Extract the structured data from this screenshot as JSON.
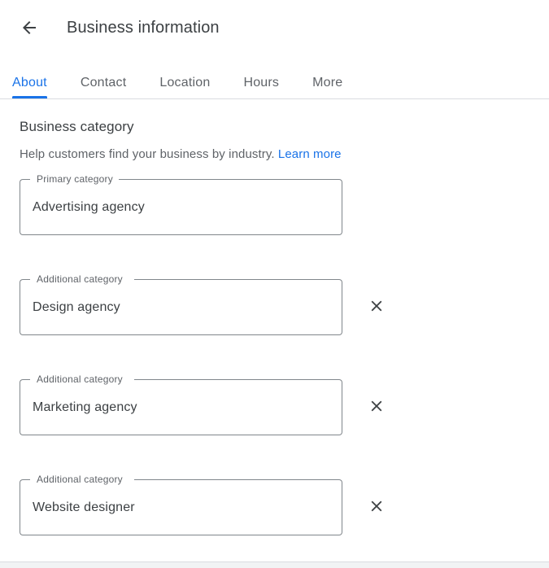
{
  "header": {
    "back_icon": "arrow-left-icon",
    "title": "Business information"
  },
  "tabs": {
    "active": "About",
    "items": [
      {
        "label": "About"
      },
      {
        "label": "Contact"
      },
      {
        "label": "Location"
      },
      {
        "label": "Hours"
      },
      {
        "label": "More"
      }
    ]
  },
  "section": {
    "heading": "Business category",
    "description": "Help customers find your business by industry.",
    "learn_more": "Learn more"
  },
  "fields": [
    {
      "label": "Primary category",
      "value": "Advertising agency",
      "removable": false,
      "remove_icon": ""
    },
    {
      "label": "Additional category",
      "value": "Design agency",
      "removable": true,
      "remove_icon": "close-icon"
    },
    {
      "label": "Additional category",
      "value": "Marketing agency",
      "removable": true,
      "remove_icon": "close-icon"
    },
    {
      "label": "Additional category",
      "value": "Website designer",
      "removable": true,
      "remove_icon": "close-icon"
    }
  ],
  "colors": {
    "accent": "#1a73e8",
    "text_primary": "#3c4043",
    "text_secondary": "#5f6368",
    "outline": "#80868b",
    "divider": "#dadce0"
  }
}
